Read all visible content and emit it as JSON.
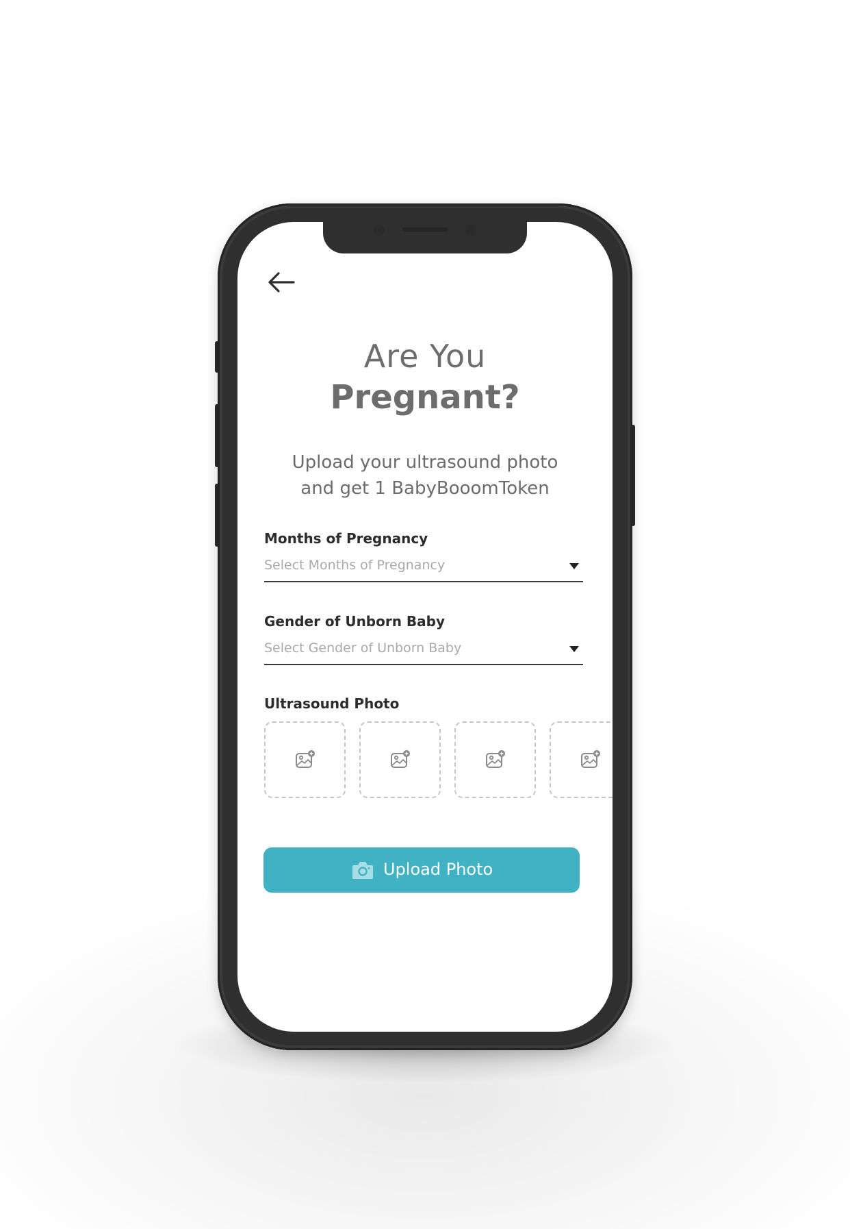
{
  "header": {
    "back_icon": "arrow-left-icon"
  },
  "title": {
    "line1": "Are You",
    "line2": "Pregnant?"
  },
  "subtitle": {
    "line1": "Upload your ultrasound photo",
    "line2": "and get 1 BabyBooomToken"
  },
  "months_field": {
    "label": "Months of Pregnancy",
    "placeholder": "Select Months of Pregnancy",
    "icon": "caret-down-icon"
  },
  "gender_field": {
    "label": "Gender of Unborn Baby",
    "placeholder": "Select Gender of Unborn Baby",
    "icon": "caret-down-icon"
  },
  "ultrasound": {
    "label": "Ultrasound Photo",
    "slot_icon": "add-image-icon"
  },
  "upload_button": {
    "label": "Upload Photo",
    "icon": "camera-icon"
  },
  "colors": {
    "accent": "#41b2c4",
    "phone_frame": "#2f2f2f",
    "heading_text": "#6d6d6d",
    "placeholder_text": "#a9a9a9"
  }
}
